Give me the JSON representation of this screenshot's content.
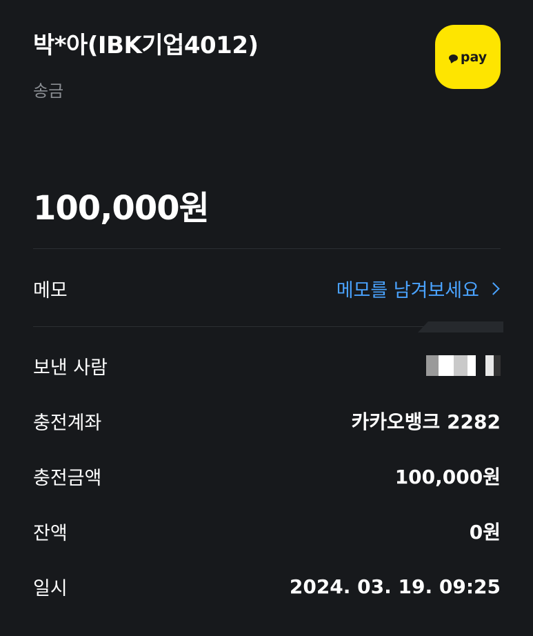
{
  "header": {
    "recipient": "박*아(IBK기업4012)",
    "transaction_type": "송금",
    "logo_text": "pay",
    "logo_color": "#fee500",
    "logo_icon": "speech-bubble-icon"
  },
  "amount": "100,000원",
  "memo": {
    "label": "메모",
    "action": "메모를 남겨보세요",
    "action_color": "#4aa3ff",
    "action_icon": "chevron-right-icon"
  },
  "details": [
    {
      "label": "보낸 사람",
      "value": ""
    },
    {
      "label": "충전계좌",
      "value": "카카오뱅크 2282"
    },
    {
      "label": "충전금액",
      "value": "100,000원"
    },
    {
      "label": "잔액",
      "value": "0원"
    },
    {
      "label": "일시",
      "value": "2024. 03. 19. 09:25"
    }
  ]
}
